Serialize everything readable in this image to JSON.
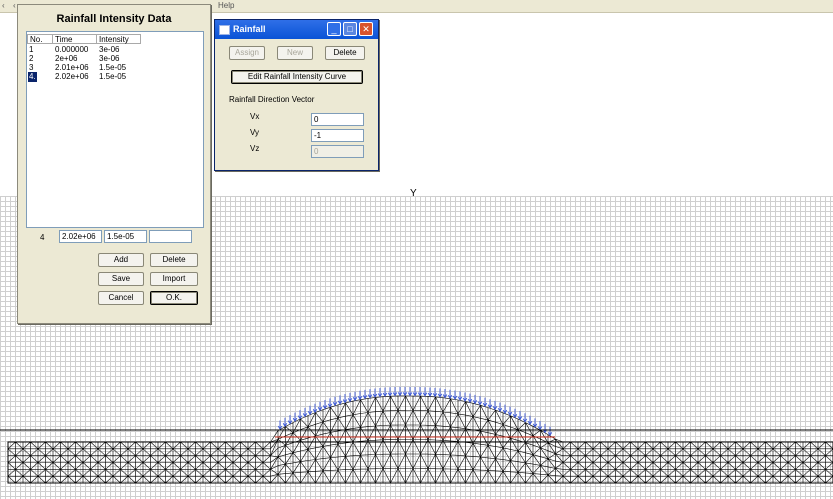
{
  "menu": {
    "help": "Help"
  },
  "view": {
    "axis_y_label": "Y"
  },
  "rainfall_intensity_dialog": {
    "title": "Rainfall Intensity Data",
    "columns": [
      "No.",
      "Time",
      "Intensity"
    ],
    "rows": [
      {
        "no": "1",
        "time": "0.000000",
        "intensity": "3e-06"
      },
      {
        "no": "2",
        "time": "2e+06",
        "intensity": "3e-06"
      },
      {
        "no": "3",
        "time": "2.01e+06",
        "intensity": "1.5e-05"
      },
      {
        "no": "4.",
        "time": "2.02e+06",
        "intensity": "1.5e-05"
      }
    ],
    "selected_row": 3,
    "edit": {
      "no": "4",
      "time": "2.02e+06",
      "intensity": "1.5e-05",
      "extra": ""
    },
    "buttons": {
      "add": "Add",
      "delete": "Delete",
      "save": "Save",
      "import": "Import",
      "cancel": "Cancel",
      "ok": "O.K."
    }
  },
  "rainfall_dialog": {
    "title": "Rainfall",
    "buttons": {
      "assign": "Assign",
      "new": "New",
      "delete": "Delete",
      "edit_curve": "Edit Rainfall Intensity Curve"
    },
    "section_label": "Rainfall Direction Vector",
    "vx_label": "Vx",
    "vx_value": "0",
    "vy_label": "Vy",
    "vy_value": "-1",
    "vz_label": "Vz",
    "vz_value": "0",
    "title_bar_icons": [
      "minimize-icon",
      "maximize-icon",
      "close-icon"
    ]
  },
  "colors": {
    "title_bar": "#0a53d6",
    "rain_arrows": "#3a57d6",
    "mesh": "#000000",
    "water_line": "#d03020",
    "grid": "#cfcfcf",
    "dialog_bg": "#ece9d4",
    "selection": "#0a246a"
  }
}
